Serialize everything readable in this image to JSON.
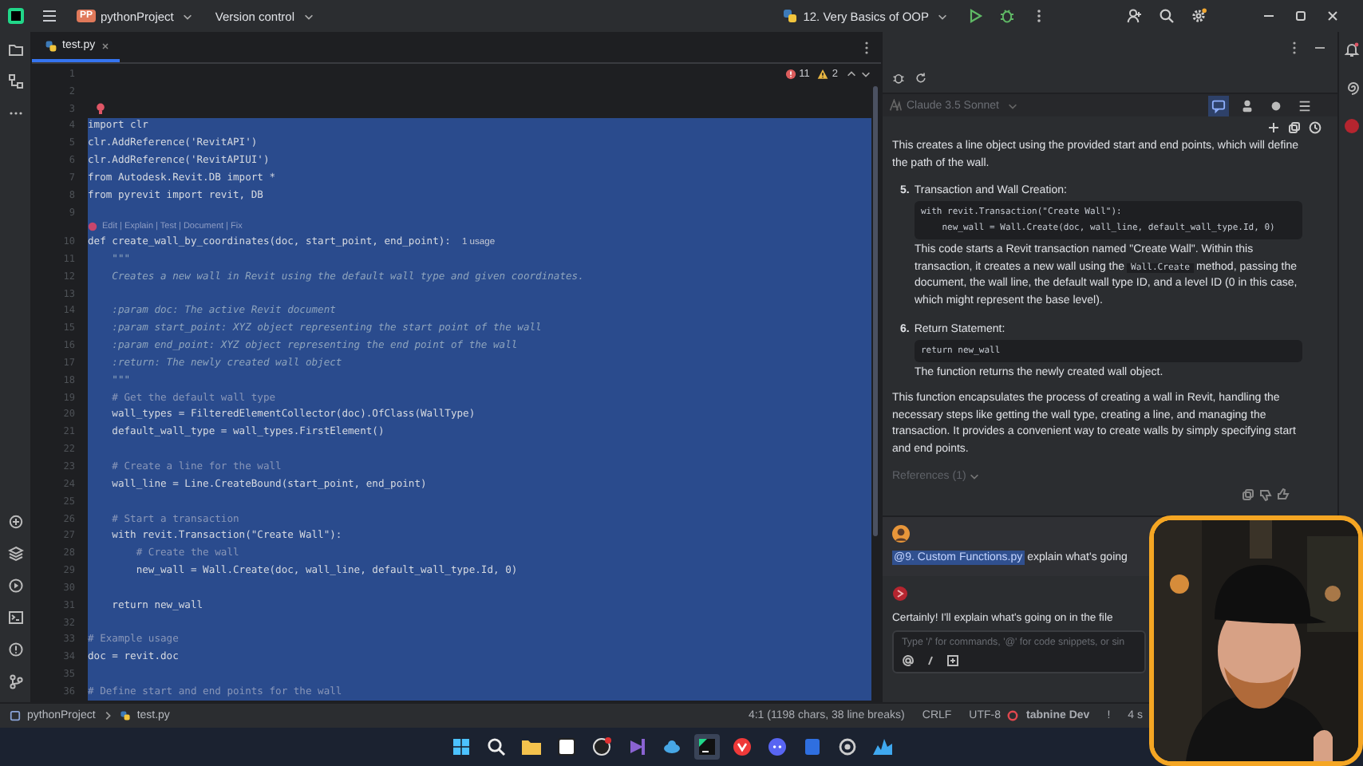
{
  "title_bar": {
    "project_badge": "PP",
    "project": "pythonProject",
    "vcs": "Version control",
    "run_config": "12. Very Basics of OOP",
    "settings_badge": true
  },
  "tabs": [
    {
      "label": "test.py",
      "selected": true
    }
  ],
  "problems": {
    "errors": "11",
    "warnings": "2"
  },
  "editor": {
    "rows": [
      {
        "kind": "code",
        "number": "1",
        "selected": false
      },
      {
        "kind": "code",
        "number": "2",
        "selected": false
      },
      {
        "kind": "code",
        "number": "3",
        "selected": false,
        "bulb": true
      },
      {
        "kind": "code",
        "number": "4",
        "text": "import clr",
        "selected": true
      },
      {
        "kind": "code",
        "number": "5",
        "text": "clr.AddReference('RevitAPI')",
        "selected": true
      },
      {
        "kind": "code",
        "number": "6",
        "text": "clr.AddReference('RevitAPIUI')",
        "selected": true
      },
      {
        "kind": "code",
        "number": "7",
        "text": "from Autodesk.Revit.DB import *",
        "selected": true
      },
      {
        "kind": "code",
        "number": "8",
        "text": "from pyrevit import revit, DB",
        "selected": true
      },
      {
        "kind": "code",
        "number": "9",
        "selected": true
      },
      {
        "kind": "codelens",
        "text": "Edit | Explain | Test | Document | Fix",
        "selected": true
      },
      {
        "kind": "code",
        "number": "10",
        "text": "def create_wall_by_coordinates(doc, start_point, end_point):",
        "hint": "1 usage",
        "selected": true
      },
      {
        "kind": "docstring",
        "number": "11",
        "text": "    \"\"\"",
        "selected": true
      },
      {
        "kind": "docstring",
        "number": "12",
        "text": "    Creates a new wall in Revit using the default wall type and given coordinates.",
        "selected": true
      },
      {
        "kind": "docstring",
        "number": "13",
        "selected": true
      },
      {
        "kind": "docstring",
        "number": "14",
        "text": "    :param doc: The active Revit document",
        "selected": true
      },
      {
        "kind": "docstring",
        "number": "15",
        "text": "    :param start_point: XYZ object representing the start point of the wall",
        "selected": true
      },
      {
        "kind": "docstring",
        "number": "16",
        "text": "    :param end_point: XYZ object representing the end point of the wall",
        "selected": true
      },
      {
        "kind": "docstring",
        "number": "17",
        "text": "    :return: The newly created wall object",
        "selected": true
      },
      {
        "kind": "docstring",
        "number": "18",
        "text": "    \"\"\"",
        "selected": true
      },
      {
        "kind": "comment",
        "number": "19",
        "text": "    # Get the default wall type",
        "selected": true
      },
      {
        "kind": "code",
        "number": "20",
        "text": "    wall_types = FilteredElementCollector(doc).OfClass(WallType)",
        "selected": true
      },
      {
        "kind": "code",
        "number": "21",
        "text": "    default_wall_type = wall_types.FirstElement()",
        "selected": true
      },
      {
        "kind": "code",
        "number": "22",
        "selected": true
      },
      {
        "kind": "comment",
        "number": "23",
        "text": "    # Create a line for the wall",
        "selected": true
      },
      {
        "kind": "code",
        "number": "24",
        "text": "    wall_line = Line.CreateBound(start_point, end_point)",
        "selected": true
      },
      {
        "kind": "code",
        "number": "25",
        "selected": true
      },
      {
        "kind": "comment",
        "number": "26",
        "text": "    # Start a transaction",
        "selected": true
      },
      {
        "kind": "code",
        "number": "27",
        "text": "    with revit.Transaction(\"Create Wall\"):",
        "selected": true
      },
      {
        "kind": "comment",
        "number": "28",
        "text": "        # Create the wall",
        "selected": true
      },
      {
        "kind": "code",
        "number": "29",
        "text": "        new_wall = Wall.Create(doc, wall_line, default_wall_type.Id, 0)",
        "selected": true
      },
      {
        "kind": "code",
        "number": "30",
        "selected": true
      },
      {
        "kind": "code",
        "number": "31",
        "text": "    return new_wall",
        "selected": true
      },
      {
        "kind": "code",
        "number": "32",
        "selected": true
      },
      {
        "kind": "comment",
        "number": "33",
        "text": "# Example usage",
        "selected": true
      },
      {
        "kind": "code",
        "number": "34",
        "text": "doc = revit.doc",
        "selected": true
      },
      {
        "kind": "code",
        "number": "35",
        "selected": true
      },
      {
        "kind": "comment",
        "number": "36",
        "text": "# Define start and end points for the wall",
        "selected": true
      }
    ]
  },
  "assistant": {
    "model": "Claude 3.5 Sonnet",
    "intro": "This creates a line object using the provided start and end points, which will define the path of the wall.",
    "steps": [
      {
        "number": "5.",
        "title": "Transaction and Wall Creation:",
        "code": [
          "with revit.Transaction(\"Create Wall\"):",
          "    new_wall = Wall.Create(doc, wall_line, default_wall_type.Id, 0)"
        ],
        "parts": [
          {
            "kind": "text",
            "text": "This code starts a Revit transaction named \"Create Wall\". Within this transaction, it creates a new wall using the"
          },
          {
            "kind": "code",
            "text": "Wall.Create"
          },
          {
            "kind": "text",
            "text": "method, passing the document, the wall line, the default wall type ID, and a level ID (0 in this case, which might represent the base level)."
          }
        ]
      },
      {
        "number": "6.",
        "title": "Return Statement:",
        "code": [
          "return new_wall"
        ],
        "parts": [
          {
            "kind": "text",
            "text": "The function returns the newly created wall object."
          }
        ]
      }
    ],
    "summary": "This function encapsulates the process of creating a wall in Revit, handling the necessary steps like getting the wall type, creating a line, and managing the transaction. It provides a convenient way to create walls by simply specifying start and end points.",
    "references": "References (1)",
    "user_message": {
      "mention": "@9. Custom Functions.py",
      "text": "explain what's going"
    },
    "reply": "Certainly! I'll explain what's going on in the file",
    "input": {
      "placeholder": "Type '/' for commands, '@' for code snippets, or sin"
    }
  },
  "status_bar": {
    "breadcrumbs": [
      "pythonProject",
      "test.py"
    ],
    "items": [
      "4:1 (1198 chars, 38 line breaks)",
      "CRLF",
      "UTF-8"
    ],
    "plugin": "tabnine Dev",
    "alert": "!",
    "indent": "4 s"
  },
  "taskbar": {
    "apps": [
      {
        "kind": "start",
        "active": false
      },
      {
        "kind": "search",
        "active": false
      },
      {
        "kind": "folder",
        "active": false
      },
      {
        "kind": "square",
        "active": false
      },
      {
        "kind": "aperture",
        "active": false
      },
      {
        "kind": "ribbon",
        "active": false
      },
      {
        "kind": "cloud",
        "active": false
      },
      {
        "kind": "ide",
        "active": true
      },
      {
        "kind": "vee",
        "active": false
      },
      {
        "kind": "chat",
        "active": false
      },
      {
        "kind": "tile",
        "active": false
      },
      {
        "kind": "ring",
        "active": false
      },
      {
        "kind": "wave",
        "active": false
      }
    ]
  }
}
